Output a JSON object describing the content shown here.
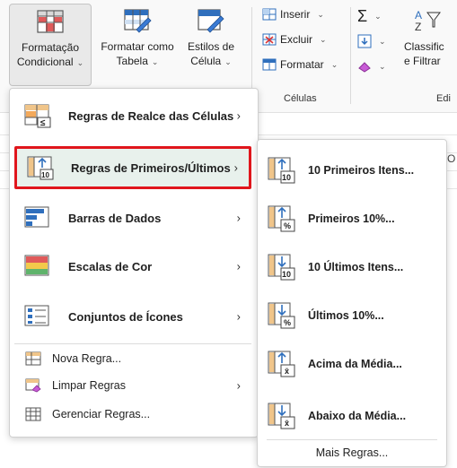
{
  "ribbon": {
    "conditional_formatting": {
      "line1": "Formatação",
      "line2": "Condicional",
      "caret": "⌄"
    },
    "format_as_table": {
      "line1": "Formatar como",
      "line2": "Tabela",
      "caret": "⌄"
    },
    "cell_styles": {
      "line1": "Estilos de",
      "line2": "Célula",
      "caret": "⌄"
    },
    "cells": {
      "insert": "Inserir",
      "delete": "Excluir",
      "format": "Formatar",
      "group_label": "Células"
    },
    "editing": {
      "sort_filter_line1": "Classific",
      "sort_filter_line2": "e Filtrar",
      "group_label_partial": "Edi"
    }
  },
  "sheet": {
    "column_partial": "O"
  },
  "menu": {
    "items": [
      {
        "label": "Regras de Realce das Células",
        "arrow": "›",
        "mnemonic_prefix": "",
        "mnemonic": "R",
        "rest": "egras de Realce das Células"
      },
      {
        "label": "Regras de Primeiros/Últimos",
        "arrow": "›"
      },
      {
        "label": "Barras de Dados",
        "arrow": "›"
      },
      {
        "label": "Escalas de Cor",
        "arrow": "›"
      },
      {
        "label": "Conjuntos de Ícones",
        "arrow": "›"
      }
    ],
    "small_items": [
      {
        "label": "Nova Regra..."
      },
      {
        "label": "Limpar Regras",
        "arrow": "›"
      },
      {
        "label": "Gerenciar Regras..."
      }
    ]
  },
  "submenu": {
    "items": [
      {
        "label": "10 Primeiros Itens...",
        "icon_text": "10"
      },
      {
        "label": "Primeiros 10%...",
        "icon_text": "%"
      },
      {
        "label": "10 Últimos Itens...",
        "icon_text": "10"
      },
      {
        "label": "Últimos 10%...",
        "icon_text": "%"
      },
      {
        "label": "Acima da Média...",
        "icon_text": "x̄"
      },
      {
        "label": "Abaixo da Média...",
        "icon_text": "x̄"
      }
    ],
    "more": "Mais Regras..."
  },
  "colors": {
    "highlight_border": "#e0161c",
    "highlight_bg": "#e8f1ec",
    "accent_blue": "#2f6fbd",
    "accent_green": "#1f7a45"
  }
}
